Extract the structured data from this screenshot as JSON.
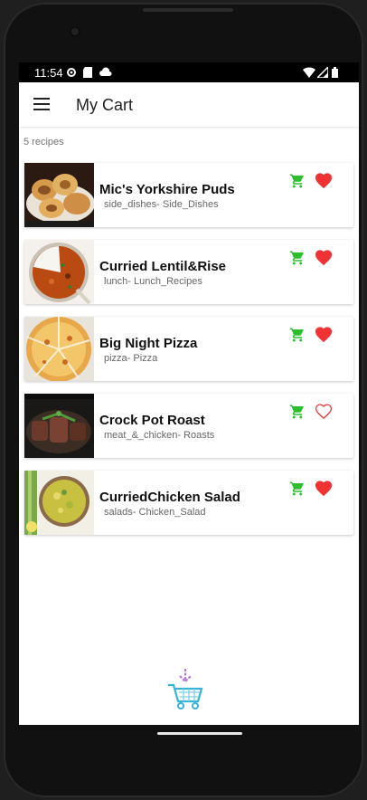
{
  "status_bar": {
    "time": "11:54"
  },
  "app_bar": {
    "title": "My Cart",
    "menu_icon": "hamburger-menu-icon"
  },
  "recipes_count": "5 recipes",
  "colors": {
    "cart_green": "#2bc02b",
    "heart_red": "#f03232"
  },
  "recipes": [
    {
      "name": "Mic's Yorkshire Puds",
      "category": "side_dishes- Side_Dishes",
      "favorite": true
    },
    {
      "name": "Curried Lentil&Rise",
      "category": "lunch- Lunch_Recipes",
      "favorite": true
    },
    {
      "name": "Big Night Pizza",
      "category": "pizza- Pizza",
      "favorite": true
    },
    {
      "name": "Crock Pot Roast",
      "category": "meat_&_chicken- Roasts",
      "favorite": false
    },
    {
      "name": "CurriedChicken Salad",
      "category": "salads- Chicken_Salad",
      "favorite": true
    }
  ]
}
